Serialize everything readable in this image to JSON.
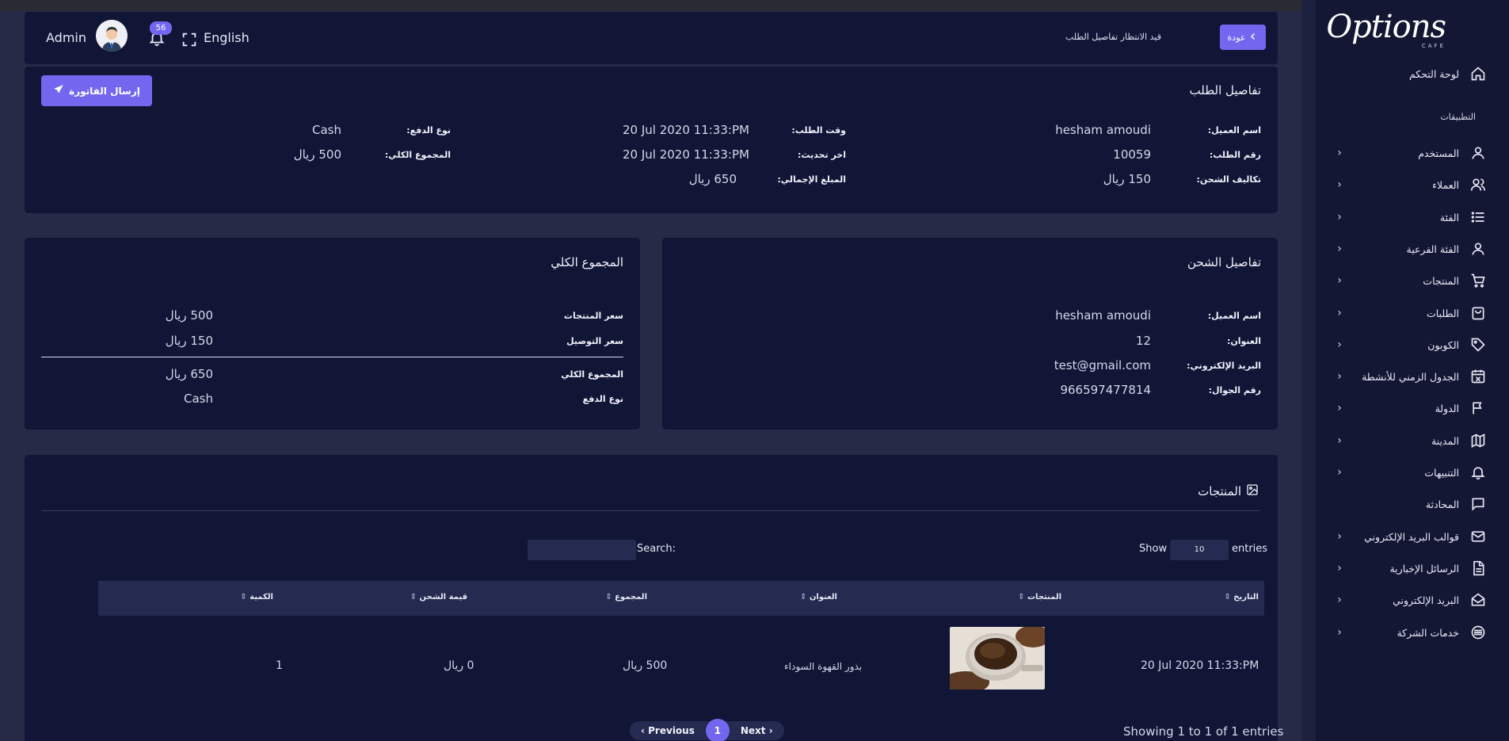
{
  "header": {
    "user_name": "Admin",
    "notifications_count": "56",
    "language": "English",
    "breadcrumb": "قيد الانتظار تفاصيل الطلب",
    "back_label": "عودة"
  },
  "sidebar": {
    "logo_text": "Options",
    "logo_sub": "CAFE",
    "dashboard": "لوحة التحكم",
    "section_label": "التطبيقات",
    "items": [
      {
        "label": "المستخدم",
        "icon": "user-icon"
      },
      {
        "label": "العملاء",
        "icon": "users-icon"
      },
      {
        "label": "الفئة",
        "icon": "list-icon"
      },
      {
        "label": "الفئة الفرعية",
        "icon": "user-icon"
      },
      {
        "label": "المنتجات",
        "icon": "cart-icon"
      },
      {
        "label": "الطلبات",
        "icon": "bag-icon"
      },
      {
        "label": "الكوبون",
        "icon": "tag-icon"
      },
      {
        "label": "الجدول الزمني للأنشطة",
        "icon": "calendar-icon"
      },
      {
        "label": "الدولة",
        "icon": "flag-icon"
      },
      {
        "label": "المدينة",
        "icon": "map-icon"
      },
      {
        "label": "التنبيهات",
        "icon": "bell-icon"
      },
      {
        "label": "المحادثة",
        "icon": "chat-icon"
      },
      {
        "label": "قوالب البريد الإلكتروني",
        "icon": "mail-icon"
      },
      {
        "label": "الرسائل الإخبارية",
        "icon": "file-icon"
      },
      {
        "label": "البريد الإلكتروني",
        "icon": "envelope-open-icon"
      },
      {
        "label": "خدمات الشركة",
        "icon": "services-icon"
      }
    ]
  },
  "order_details": {
    "title": "تفاصيل الطلب",
    "send_invoice": "إرسال الفاتورة",
    "customer_name_label": "اسم العميل:",
    "customer_name": "hesham amoudi",
    "order_number_label": "رقم الطلب:",
    "order_number": "10059",
    "shipping_cost_label": "تكاليف الشحن:",
    "shipping_cost": "150 ريال",
    "order_time_label": "وقت الطلب:",
    "order_time": "20 Jul 2020 11:33:PM",
    "last_update_label": "اخر تحديث:",
    "last_update": "20 Jul 2020 11:33:PM",
    "total_amount_label": "المبلغ الإجمالي:",
    "total_amount": "650 ريال",
    "payment_type_label": "نوع الدفع:",
    "payment_type": "Cash",
    "grand_total_label": "المجموع الكلي:",
    "grand_total": "500 ريال"
  },
  "shipping_details": {
    "title": "تفاصيل الشحن",
    "customer_name_label": "اسم العميل:",
    "customer_name": "hesham amoudi",
    "address_label": "العنوان:",
    "address": "12",
    "email_label": "البريد الإلكتروني:",
    "email": "test@gmail.com",
    "phone_label": "رقم الجوال:",
    "phone": "966597477814"
  },
  "totals": {
    "title": "المجموع الكلي",
    "products_price_label": "سعر المنتجات",
    "products_price": "500 ريال",
    "delivery_price_label": "سعر التوصيل",
    "delivery_price": "150 ريال",
    "grand_total_label": "المجموع الكلي",
    "grand_total": "650 ريال",
    "payment_type_label": "نوع الدفع",
    "payment_type": "Cash"
  },
  "products": {
    "title": "المنتجات",
    "show_label": "Show",
    "entries_value": "10",
    "entries_label": "entries",
    "search_label": "Search:",
    "columns": [
      "التاريخ",
      "المنتجات",
      "العنوان",
      "المجموع",
      "قيمة الشحن",
      "الكمية"
    ],
    "rows": [
      {
        "date": "20 Jul 2020 11:33:PM",
        "title": "بذور القهوة السوداء",
        "total": "500 ريال",
        "shipping": "0 ريال",
        "quantity": "1"
      }
    ],
    "info": "Showing 1 to 1 of 1 entries",
    "prev": "Previous",
    "page": "1",
    "next": "Next"
  }
}
